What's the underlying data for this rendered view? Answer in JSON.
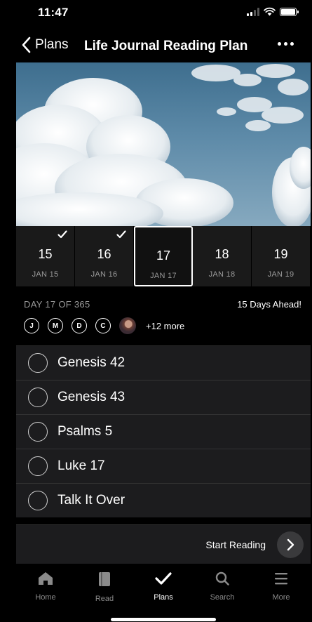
{
  "status_bar": {
    "time": "11:47"
  },
  "nav": {
    "back_label": "Plans",
    "title": "Life Journal Reading Plan"
  },
  "days": [
    {
      "num": "15",
      "date": "JAN 15",
      "completed": true,
      "selected": false
    },
    {
      "num": "16",
      "date": "JAN 16",
      "completed": true,
      "selected": false
    },
    {
      "num": "17",
      "date": "JAN 17",
      "completed": false,
      "selected": true
    },
    {
      "num": "18",
      "date": "JAN 18",
      "completed": false,
      "selected": false
    },
    {
      "num": "19",
      "date": "JAN 19",
      "completed": false,
      "selected": false
    }
  ],
  "progress": {
    "label": "DAY 17 OF 365",
    "ahead": "15 Days Ahead!"
  },
  "friends": {
    "initials": [
      "J",
      "M",
      "D",
      "C"
    ],
    "more": "+12 more"
  },
  "readings": [
    "Genesis 42",
    "Genesis 43",
    "Psalms 5",
    "Luke 17",
    "Talk It Over"
  ],
  "start": {
    "label": "Start Reading"
  },
  "tabs": [
    {
      "label": "Home",
      "icon": "home-icon",
      "active": false
    },
    {
      "label": "Read",
      "icon": "book-icon",
      "active": false
    },
    {
      "label": "Plans",
      "icon": "check-icon",
      "active": true
    },
    {
      "label": "Search",
      "icon": "search-icon",
      "active": false
    },
    {
      "label": "More",
      "icon": "menu-icon",
      "active": false
    }
  ],
  "colors": {
    "background": "#000000",
    "row": "#1c1c1e",
    "muted": "#9a9a9a"
  }
}
